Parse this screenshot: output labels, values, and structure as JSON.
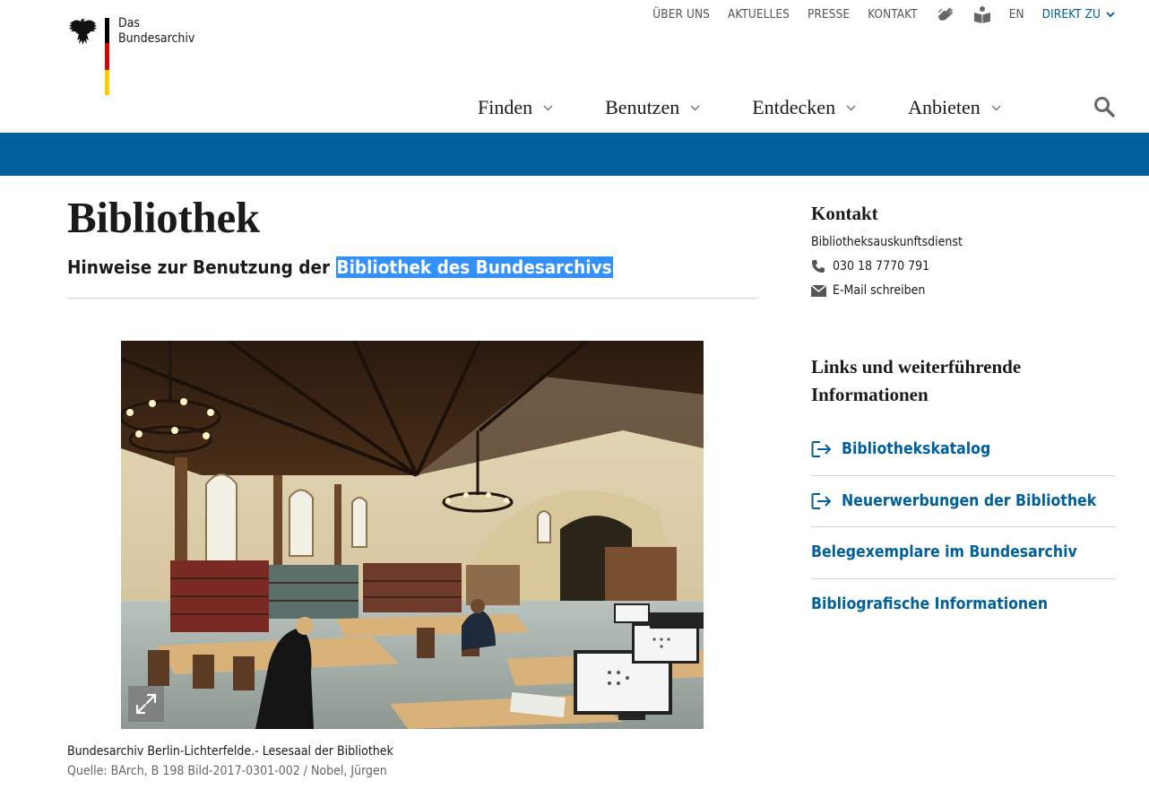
{
  "logo": {
    "line1": "Das",
    "line2": "Bundesarchiv"
  },
  "topnav": {
    "items": [
      "ÜBER UNS",
      "AKTUELLES",
      "PRESSE",
      "KONTAKT"
    ],
    "sign_language_icon": "sign-language-icon",
    "easy_language_icon": "easy-language-icon",
    "lang": "EN",
    "direkt": "DIREKT ZU"
  },
  "mainnav": {
    "items": [
      "Finden",
      "Benutzen",
      "Entdecken",
      "Anbieten"
    ]
  },
  "colors": {
    "brand_blue": "#00609c",
    "highlight": "#3390ff"
  },
  "main": {
    "title": "Bibliothek",
    "subtitle_prefix": "Hinweise zur Benutzung der ",
    "subtitle_highlight": "Bibliothek des Bundesarchivs",
    "image_caption": "Bundesarchiv Berlin-Lichterfelde.- Lesesaal der Bibliothek",
    "image_source": "Quelle: BArch, B 198 Bild-2017-0301-002 / Nobel, Jürgen"
  },
  "sidebar": {
    "kontakt_title": "Kontakt",
    "service": "Bibliotheksauskunftsdienst",
    "phone": "030 18 7770 791",
    "email_label": "E-Mail schreiben",
    "links_title": "Links und weiterführende Informationen",
    "links": [
      {
        "label": "Bibliothekskatalog",
        "external": true
      },
      {
        "label": "Neuerwerbungen der Bibliothek",
        "external": true
      },
      {
        "label": "Belegexemplare im Bundesarchiv",
        "external": false
      },
      {
        "label": "Bibliografische Informationen",
        "external": false
      }
    ]
  }
}
